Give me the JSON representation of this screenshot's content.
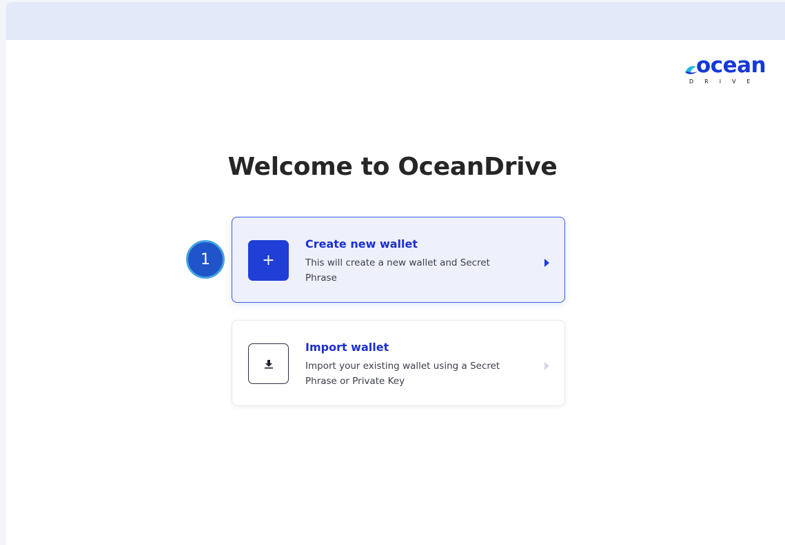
{
  "app": {
    "logo_text": "ocean",
    "logo_sub": "DRIVE"
  },
  "main": {
    "title": "Welcome to OceanDrive",
    "options": [
      {
        "title": "Create new wallet",
        "description": "This will create a new wallet and Secret Phrase",
        "icon": "plus-icon",
        "icon_glyph": "+"
      },
      {
        "title": "Import wallet",
        "description": "Import your existing wallet using a Secret Phrase or Private Key",
        "icon": "download-icon"
      }
    ]
  },
  "step_marker": {
    "label": "1"
  },
  "colors": {
    "brand_blue": "#1f3fd6",
    "header_bar": "#e3e9f9",
    "highlight_card": "#eef1fb",
    "step_badge": "#1f55c9"
  }
}
